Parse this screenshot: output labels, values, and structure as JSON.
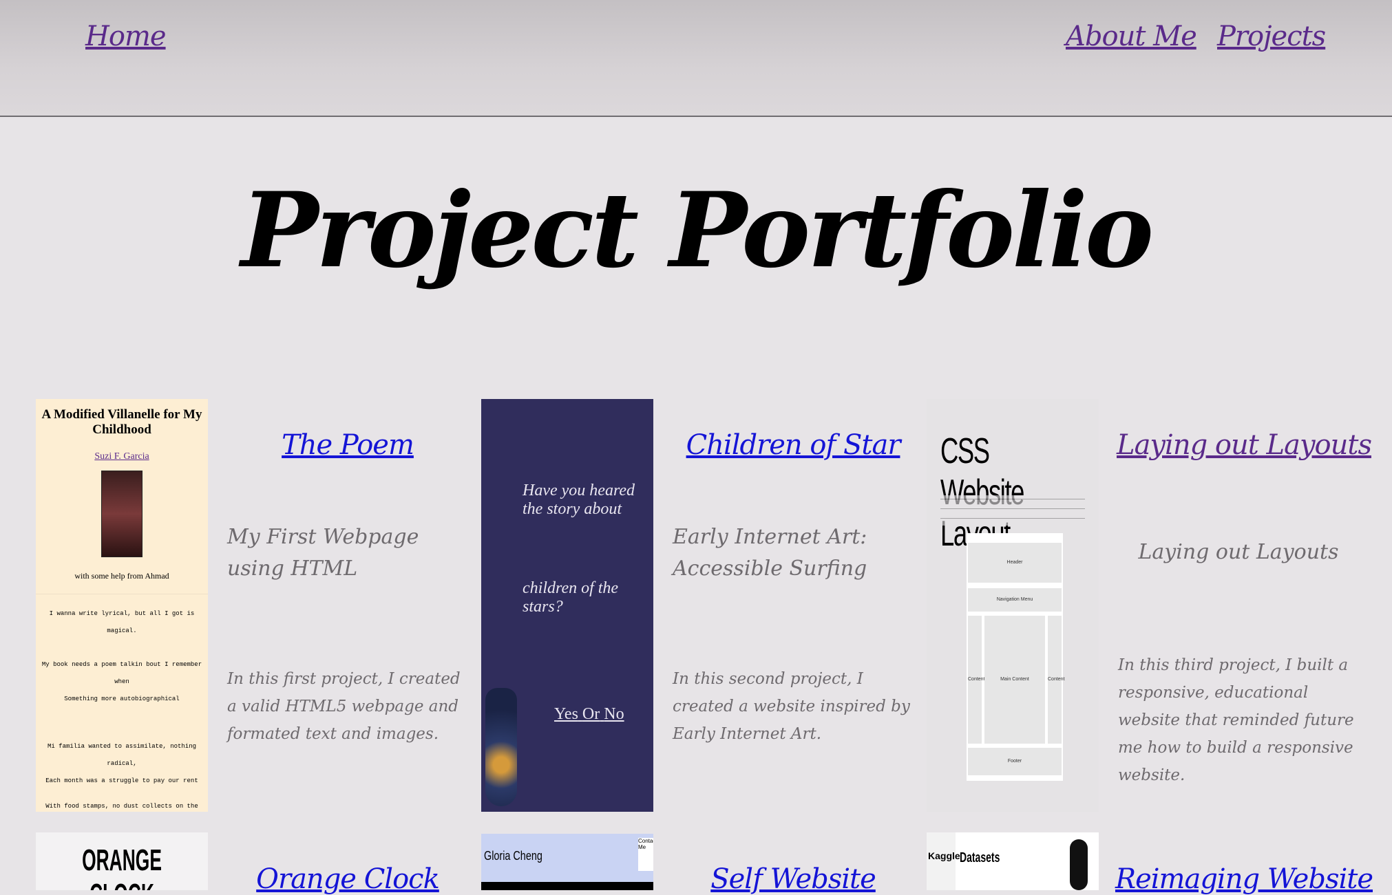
{
  "nav": {
    "home": "Home",
    "about": "About Me",
    "projects": "Projects"
  },
  "page": {
    "title": "Project Portfolio"
  },
  "projects": [
    {
      "title": "The Poem",
      "subtitle": "My First Webpage using HTML",
      "description": "In this first project, I created a valid HTML5 webpage and formated text and images.",
      "thumb": {
        "heading": "A Modified Villanelle for My Childhood",
        "author": "Suzi F. Garcia",
        "help": "with some help from Ahmad",
        "lines": [
          "I wanna write lyrical, but all I got is magical.",
          "My book needs a poem talkin bout I remember when",
          "Something more autobiographical",
          "Mi familia wanted to assimilate, nothing radical,",
          "Each month was a struggle to pay our rent",
          "With food stamps, no dust collects on the magical."
        ]
      }
    },
    {
      "title": "Children of Star",
      "subtitle": "Early Internet Art: Accessible Surfing",
      "description": "In this second project, I created a website inspired by Early Internet Art.",
      "thumb": {
        "line1": "Have you heared the story about",
        "line2": "children of the stars?",
        "yes": "Yes",
        "or": "Or",
        "no": "No"
      }
    },
    {
      "title": "Laying out Layouts",
      "subtitle": "Laying out Layouts",
      "description": "In this third project, I built a responsive, educational website that reminded future me how to build a responsive website.",
      "thumb": {
        "heading": "CSS Website Layout",
        "header": "Header",
        "nav": "Navigation Menu",
        "content_left": "Content",
        "main": "Main Content",
        "content_right": "Content",
        "footer": "Footer"
      }
    },
    {
      "title": "Orange Clock",
      "thumb": {
        "text": "ORANGE CLOCK"
      }
    },
    {
      "title": "Self Website",
      "thumb": {
        "text": "Gloria Cheng",
        "contact": "Contact Me"
      }
    },
    {
      "title": "Reimaging Website",
      "thumb": {
        "logo": "Kaggle",
        "text": "Datasets"
      }
    }
  ]
}
